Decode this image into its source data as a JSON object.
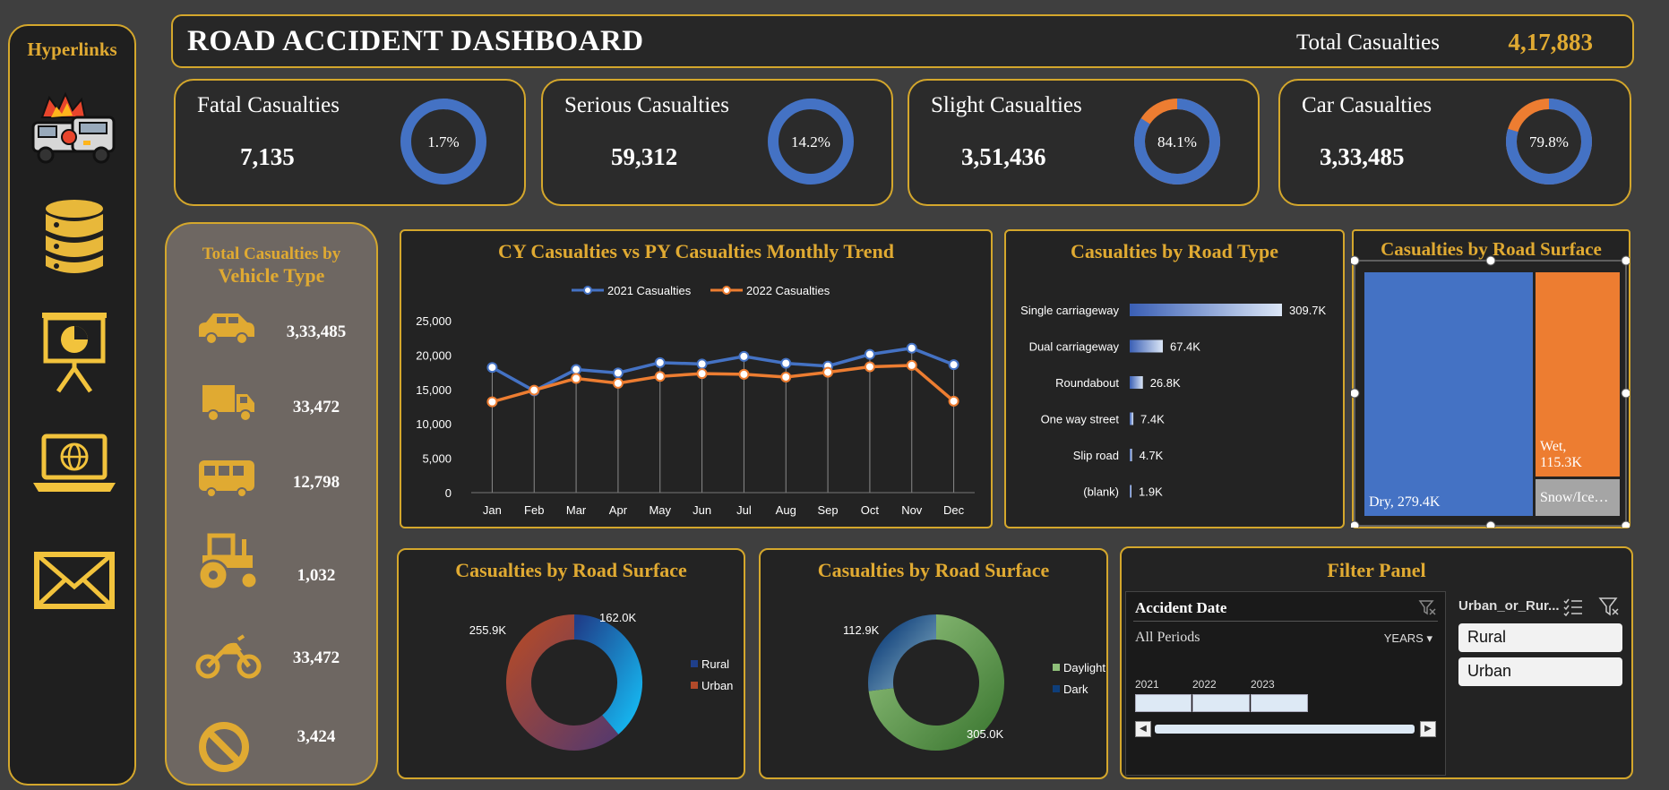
{
  "sidebar": {
    "title": "Hyperlinks",
    "icons": [
      "car-crash-icon",
      "database-icon",
      "presentation-icon",
      "laptop-globe-icon",
      "envelope-icon"
    ]
  },
  "header": {
    "title": "ROAD ACCIDENT DASHBOARD",
    "total_label": "Total Casualties",
    "total_value": "4,17,883"
  },
  "kpis": [
    {
      "label": "Fatal Casualties",
      "value": "7,135",
      "percent_text": "1.7%",
      "percent": 1.7
    },
    {
      "label": "Serious Casualties",
      "value": "59,312",
      "percent_text": "14.2%",
      "percent": 14.2
    },
    {
      "label": "Slight Casualties",
      "value": "3,51,436",
      "percent_text": "84.1%",
      "percent": 84.1
    },
    {
      "label": "Car Casualties",
      "value": "3,33,485",
      "percent_text": "79.8%",
      "percent": 79.8
    }
  ],
  "vehicle": {
    "title_line1": "Total  Casualties by",
    "title_line2": "Vehicle Type",
    "items": [
      {
        "icon": "car-icon",
        "value": "3,33,485"
      },
      {
        "icon": "truck-icon",
        "value": "33,472"
      },
      {
        "icon": "bus-icon",
        "value": "12,798"
      },
      {
        "icon": "tractor-icon",
        "value": "1,032"
      },
      {
        "icon": "motorcycle-icon",
        "value": "33,472"
      },
      {
        "icon": "prohibited-icon",
        "value": "3,424"
      }
    ]
  },
  "colors": {
    "gold": "#e0aa32",
    "blue": "#4472c4",
    "orange": "#ed7d31",
    "gray": "#a5a5a5"
  },
  "chart_data": [
    {
      "type": "line",
      "title": "CY Casualties vs PY Casualties Monthly Trend",
      "categories": [
        "Jan",
        "Feb",
        "Mar",
        "Apr",
        "May",
        "Jun",
        "Jul",
        "Aug",
        "Sep",
        "Oct",
        "Nov",
        "Dec"
      ],
      "yticks": [
        "25,000",
        "20,000",
        "15,000",
        "10,000",
        "5,000",
        "0"
      ],
      "ylim": [
        0,
        25000
      ],
      "legend": "top",
      "series": [
        {
          "name": "2021 Casualties",
          "color": "#4472c4",
          "values": [
            18200,
            14800,
            17900,
            17400,
            18900,
            18700,
            19800,
            18800,
            18400,
            20100,
            21000,
            18600
          ]
        },
        {
          "name": "2022 Casualties",
          "color": "#ed7d31",
          "values": [
            13200,
            14900,
            16600,
            15900,
            16900,
            17300,
            17200,
            16800,
            17500,
            18300,
            18500,
            13300
          ]
        }
      ]
    },
    {
      "type": "bar",
      "title": "Casualties by Road Type",
      "categories": [
        "Single carriageway",
        "Dual carriageway",
        "Roundabout",
        "One way street",
        "Slip road",
        "(blank)"
      ],
      "values": [
        309.7,
        67.4,
        26.8,
        7.4,
        4.7,
        1.9
      ],
      "labels": [
        "309.7K",
        "67.4K",
        "26.8K",
        "7.4K",
        "4.7K",
        "1.9K"
      ]
    },
    {
      "type": "treemap",
      "title": "Casualties by Road Surface",
      "items": [
        {
          "label": "Dry, 279.4K",
          "value": 279.4,
          "color": "#4472c4"
        },
        {
          "label": "Wet, 115.3K",
          "label_line1": "Wet,",
          "label_line2": "115.3K",
          "value": 115.3,
          "color": "#ed7d31"
        },
        {
          "label": "Snow/Ice…",
          "value": 23.2,
          "color": "#a5a5a5"
        }
      ]
    },
    {
      "type": "pie",
      "title": "Casualties by Road Surface",
      "legend": "right",
      "slices": [
        {
          "name": "Rural",
          "value": 162.0,
          "label": "162.0K"
        },
        {
          "name": "Urban",
          "value": 255.9,
          "label": "255.9K"
        }
      ]
    },
    {
      "type": "pie",
      "title": "Casualties by Road Surface",
      "legend": "right",
      "slices": [
        {
          "name": "Daylight",
          "value": 305.0,
          "label": "305.0K"
        },
        {
          "name": "Dark",
          "value": 112.9,
          "label": "112.9K"
        }
      ]
    }
  ],
  "filter": {
    "title": "Filter Panel",
    "date_slicer": {
      "title": "Accident Date",
      "period": "All Periods",
      "granularity": "YEARS",
      "years": [
        "2021",
        "2022",
        "2023"
      ]
    },
    "area_slicer": {
      "title": "Urban_or_Rur...",
      "options": [
        "Rural",
        "Urban"
      ]
    }
  }
}
